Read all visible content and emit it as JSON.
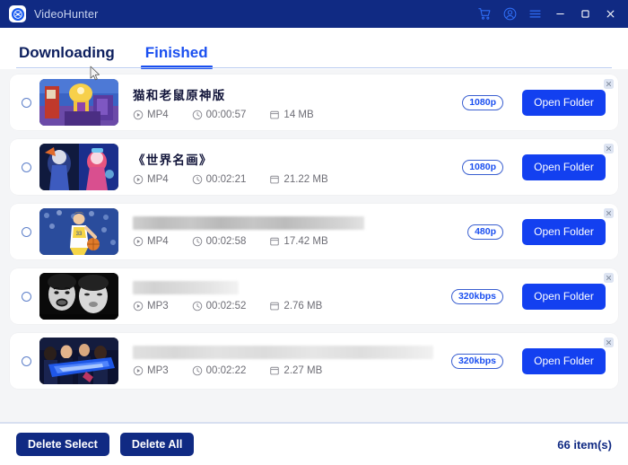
{
  "window": {
    "app_title": "VideoHunter",
    "logo_icon": "videohunter-logo-icon",
    "controls": [
      {
        "name": "cart-icon",
        "label": "Cart"
      },
      {
        "name": "account-icon",
        "label": "Account"
      },
      {
        "name": "menu-icon",
        "label": "Menu"
      },
      {
        "name": "minimize-icon",
        "label": "Minimize"
      },
      {
        "name": "maximize-icon",
        "label": "Maximize"
      },
      {
        "name": "close-icon",
        "label": "Close"
      }
    ],
    "titlebar_bg": "#102a83"
  },
  "tabs": [
    {
      "label": "Downloading",
      "active": false
    },
    {
      "label": "Finished",
      "active": true
    }
  ],
  "accent": {
    "blue": "#1340f0",
    "navy": "#102a83",
    "tab_active": "#1a4ff0"
  },
  "downloads": [
    {
      "title": "猫和老鼠原神版",
      "title_blurred": false,
      "format": "MP4",
      "duration": "00:00:57",
      "size": "14 MB",
      "quality": "1080p",
      "action_label": "Open Folder",
      "thumb": "anime-gold-character"
    },
    {
      "title": "《世界名画》",
      "title_blurred": false,
      "format": "MP4",
      "duration": "00:02:21",
      "size": "21.22 MB",
      "quality": "1080p",
      "action_label": "Open Folder",
      "thumb": "anime-blue-pink-duo"
    },
    {
      "title": "",
      "title_blurred": true,
      "format": "MP4",
      "duration": "00:02:58",
      "size": "17.42 MB",
      "quality": "480p",
      "action_label": "Open Folder",
      "thumb": "basketball-player"
    },
    {
      "title": "",
      "title_blurred": true,
      "format": "MP3",
      "duration": "00:02:52",
      "size": "2.76 MB",
      "quality": "320kbps",
      "action_label": "Open Folder",
      "thumb": "bw-portraits"
    },
    {
      "title": "",
      "title_blurred": true,
      "format": "MP3",
      "duration": "00:02:22",
      "size": "2.27 MB",
      "quality": "320kbps",
      "action_label": "Open Folder",
      "thumb": "blue-group-photo"
    }
  ],
  "footer": {
    "delete_select_label": "Delete Select",
    "delete_all_label": "Delete All",
    "item_count": "66 item(s)"
  }
}
